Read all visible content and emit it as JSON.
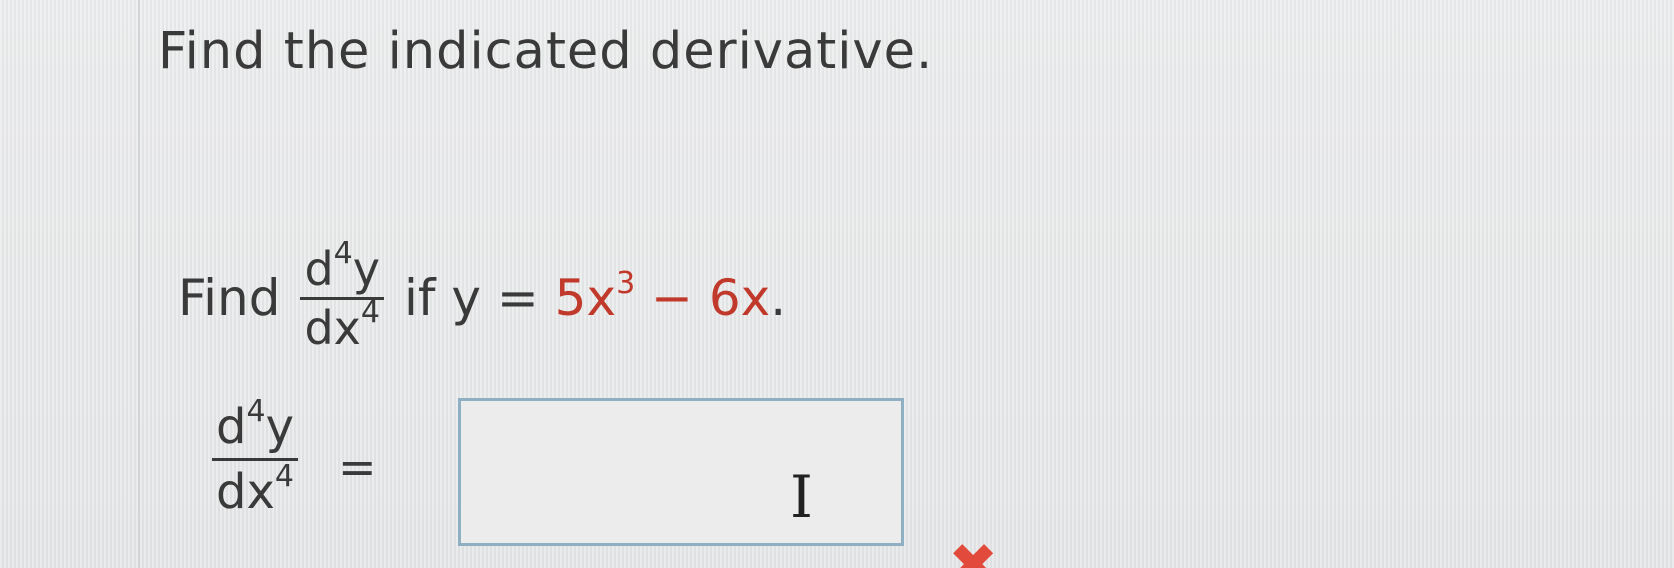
{
  "heading": "Find the indicated derivative.",
  "question": {
    "prefix": "Find",
    "derivative": {
      "num_base": "d",
      "num_exp": "4",
      "num_var": "y",
      "den_base": "dx",
      "den_exp": "4"
    },
    "condition_text": "if y =",
    "expression": {
      "coef1": "5x",
      "exp1": "3",
      "rest": " − 6x",
      "period": "."
    }
  },
  "answer": {
    "lhs": {
      "num_base": "d",
      "num_exp": "4",
      "num_var": "y",
      "den_base": "dx",
      "den_exp": "4"
    },
    "equals": "=",
    "value": "",
    "status": "incorrect"
  },
  "icons": {
    "cursor": "I",
    "incorrect": "✖"
  },
  "colors": {
    "expression": "#c0392b",
    "incorrect": "#e24a3b",
    "box_border": "#8fb0c2"
  }
}
